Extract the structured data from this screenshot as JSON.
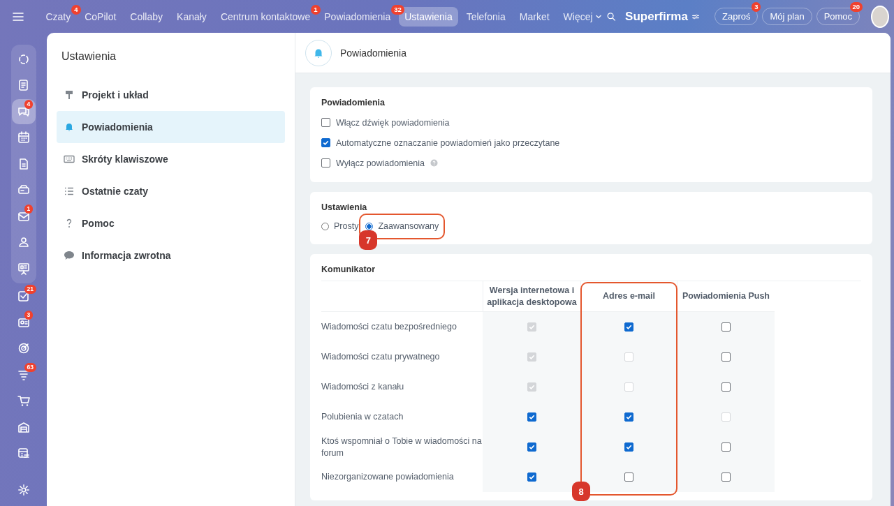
{
  "topbar": {
    "nav": [
      {
        "label": "Czaty",
        "badge": "4",
        "kind": "link",
        "selected": false
      },
      {
        "label": "CoPilot",
        "kind": "link",
        "selected": false
      },
      {
        "label": "Collaby",
        "kind": "link",
        "selected": false
      },
      {
        "label": "Kanały",
        "kind": "link",
        "selected": false
      },
      {
        "label": "Centrum kontaktowe",
        "badge": "1",
        "kind": "link",
        "selected": false
      },
      {
        "label": "Powiadomienia",
        "badge": "32",
        "kind": "link",
        "selected": false
      },
      {
        "label": "Ustawienia",
        "kind": "link",
        "selected": true
      },
      {
        "label": "Telefonia",
        "kind": "link",
        "selected": false
      },
      {
        "label": "Market",
        "kind": "link",
        "selected": false
      },
      {
        "label": "Więcej",
        "kind": "dropdown",
        "selected": false
      }
    ],
    "brand": "Superfirma",
    "actions": [
      {
        "label": "Zaproś",
        "badge": "3"
      },
      {
        "label": "Mój plan"
      },
      {
        "label": "Pomoc",
        "badge": "20"
      }
    ]
  },
  "rail": [
    {
      "selected": false
    },
    {
      "selected": false
    },
    {
      "badge": "4",
      "selected": true
    },
    {
      "selected": false
    },
    {
      "selected": false
    },
    {
      "selected": false
    },
    {
      "badge": "1",
      "selected": false
    },
    {
      "selected": false
    },
    {
      "selected": false
    },
    {
      "badge": "21",
      "selected": false
    },
    {
      "badge": "3",
      "selected": false
    },
    {
      "selected": false
    },
    {
      "badge": "63",
      "selected": false
    },
    {
      "selected": false
    },
    {
      "selected": false
    },
    {
      "selected": false
    }
  ],
  "settings_nav": {
    "title": "Ustawienia",
    "items": [
      {
        "label": "Projekt i układ",
        "selected": false
      },
      {
        "label": "Powiadomienia",
        "selected": true
      },
      {
        "label": "Skróty klawiszowe",
        "selected": false
      },
      {
        "label": "Ostatnie czaty",
        "selected": false
      },
      {
        "label": "Pomoc",
        "selected": false
      },
      {
        "label": "Informacja zwrotna",
        "selected": false
      }
    ]
  },
  "content": {
    "title": "Powiadomienia",
    "sections": [
      {
        "kind": "checkboxes",
        "title": "Powiadomienia",
        "options": [
          {
            "label": "Włącz dźwięk powiadomienia",
            "checked": false,
            "help": false
          },
          {
            "label": "Automatyczne oznaczanie powiadomień jako przeczytane",
            "checked": true,
            "help": false
          },
          {
            "label": "Wyłącz powiadomienia",
            "checked": false,
            "help": true
          }
        ]
      },
      {
        "kind": "radios",
        "title": "Ustawienia",
        "callout": "7",
        "options": [
          {
            "label": "Prosty",
            "selected": false
          },
          {
            "label": "Zaawansowany",
            "selected": true
          }
        ]
      },
      {
        "kind": "matrix",
        "title": "Komunikator",
        "callout": "8",
        "columns": [
          "Wersja internetowa i aplikacja desktopowa",
          "Adres e-mail",
          "Powiadomienia Push"
        ],
        "rows": [
          {
            "label": "Wiadomości czatu bezpośredniego",
            "cells": [
              {
                "checked": true,
                "disabled": true
              },
              {
                "checked": true,
                "disabled": false
              },
              {
                "checked": false,
                "disabled": false
              }
            ]
          },
          {
            "label": "Wiadomości czatu prywatnego",
            "cells": [
              {
                "checked": true,
                "disabled": true
              },
              {
                "checked": false,
                "disabled": true
              },
              {
                "checked": false,
                "disabled": false
              }
            ]
          },
          {
            "label": "Wiadomości z kanału",
            "cells": [
              {
                "checked": true,
                "disabled": true
              },
              {
                "checked": false,
                "disabled": true
              },
              {
                "checked": false,
                "disabled": false
              }
            ]
          },
          {
            "label": "Polubienia w czatach",
            "cells": [
              {
                "checked": true,
                "disabled": false
              },
              {
                "checked": true,
                "disabled": false
              },
              {
                "checked": false,
                "disabled": true
              }
            ]
          },
          {
            "label": "Ktoś wspomniał o Tobie w wiadomości na forum",
            "cells": [
              {
                "checked": true,
                "disabled": false
              },
              {
                "checked": true,
                "disabled": false
              },
              {
                "checked": false,
                "disabled": false
              }
            ]
          },
          {
            "label": "Niezorganizowane powiadomienia",
            "cells": [
              {
                "checked": true,
                "disabled": false
              },
              {
                "checked": false,
                "disabled": false
              },
              {
                "checked": false,
                "disabled": false
              }
            ]
          }
        ]
      }
    ]
  }
}
